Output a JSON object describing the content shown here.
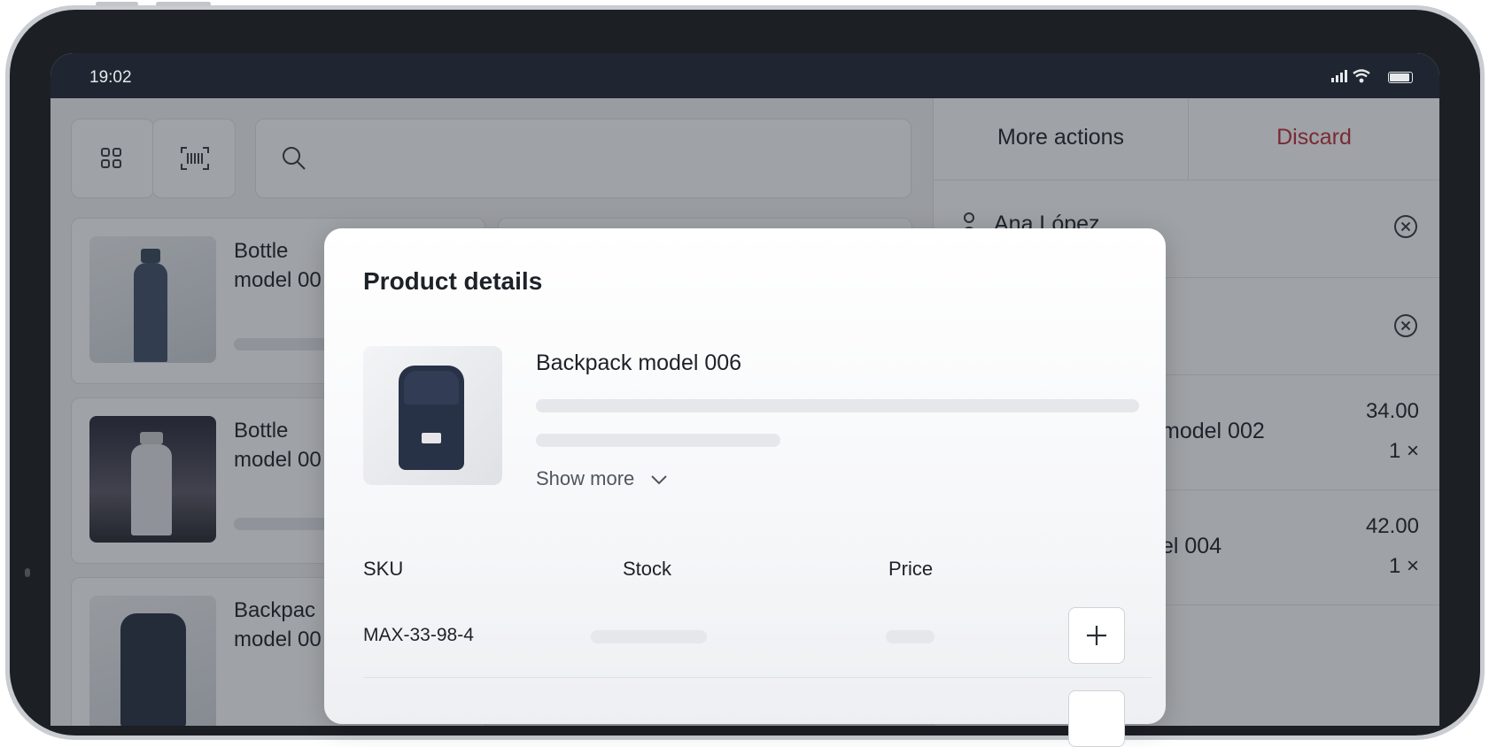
{
  "status_bar": {
    "time": "19:02"
  },
  "icons": {
    "grid": "grid-icon",
    "barcode": "barcode-icon",
    "search": "search-icon",
    "user": "user-icon",
    "remove": "close-circle-icon",
    "chevron": "chevron-down-icon",
    "plus": "plus-icon"
  },
  "products": [
    {
      "name": "Bottle\nmodel 00"
    },
    {
      "name": "Bottle\nmodel 00"
    },
    {
      "name": "Backpac\nmodel 00"
    }
  ],
  "right_pane": {
    "more_actions": "More actions",
    "discard": "Discard",
    "customer": "Ana López",
    "lines": [
      {
        "name": "model 002",
        "price": "34.00",
        "qty": "1 ×"
      },
      {
        "name": "el 004",
        "price": "42.00",
        "qty": "1 ×"
      }
    ]
  },
  "modal": {
    "title": "Product details",
    "product_name": "Backpack model 006",
    "show_more": "Show more",
    "columns": {
      "sku": "SKU",
      "stock": "Stock",
      "price": "Price"
    },
    "rows": [
      {
        "sku": "MAX-33-98-4"
      }
    ]
  },
  "colors": {
    "discard": "#c0313d",
    "statusbar": "#1f2531",
    "overlay": "rgba(27,33,44,0.42)"
  }
}
